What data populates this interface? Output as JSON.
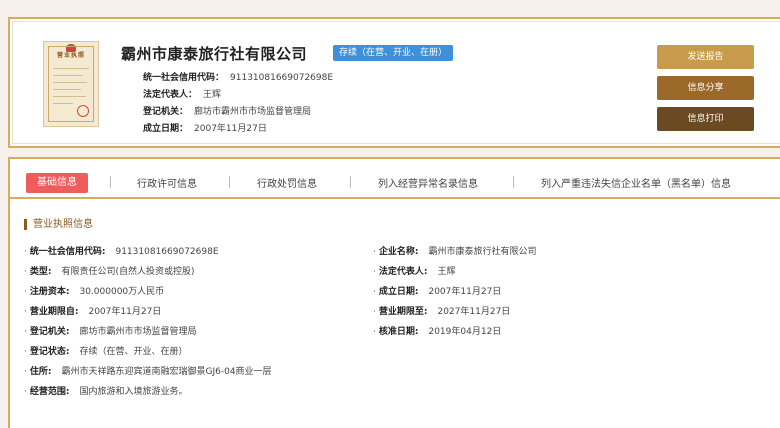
{
  "company": {
    "name": "霸州市康泰旅行社有限公司",
    "status_tag": "存续（在营、开业、在册）",
    "license_title": "营业执照"
  },
  "summary": [
    {
      "label": "统一社会信用代码：",
      "value": "91131081669072698E"
    },
    {
      "label": "法定代表人：",
      "value": "王辉"
    },
    {
      "label": "登记机关：",
      "value": "廊坊市霸州市市场监督管理局"
    },
    {
      "label": "成立日期：",
      "value": "2007年11月27日"
    }
  ],
  "actions": {
    "report": "发送报告",
    "share": "信息分享",
    "print": "信息打印"
  },
  "tabs": [
    {
      "label": "基础信息",
      "active": true
    },
    {
      "label": "行政许可信息",
      "active": false
    },
    {
      "label": "行政处罚信息",
      "active": false
    },
    {
      "label": "列入经营异常名录信息",
      "active": false
    },
    {
      "label": "列入严重违法失信企业名单（黑名单）信息",
      "active": false
    }
  ],
  "section": {
    "title": "营业执照信息"
  },
  "details_left": [
    {
      "label": "统一社会信用代码:",
      "value": "91131081669072698E"
    },
    {
      "label": "类型:",
      "value": "有限责任公司(自然人投资或控股)"
    },
    {
      "label": "注册资本:",
      "value": "30.000000万人民币"
    },
    {
      "label": "营业期限自:",
      "value": "2007年11月27日"
    },
    {
      "label": "登记机关:",
      "value": "廊坊市霸州市市场监督管理局"
    },
    {
      "label": "登记状态:",
      "value": "存续（在营、开业、在册）"
    },
    {
      "label": "住所:",
      "value": "霸州市天祥路东迎宾道南融宏瑞御景GJ6-04商业一层"
    },
    {
      "label": "经营范围:",
      "value": "国内旅游和入境旅游业务。"
    }
  ],
  "details_right": [
    {
      "label": "企业名称:",
      "value": "霸州市康泰旅行社有限公司"
    },
    {
      "label": "法定代表人:",
      "value": "王辉"
    },
    {
      "label": "成立日期:",
      "value": "2007年11月27日"
    },
    {
      "label": "营业期限至:",
      "value": "2027年11月27日"
    },
    {
      "label": "核准日期:",
      "value": "2019年04月12日"
    }
  ]
}
